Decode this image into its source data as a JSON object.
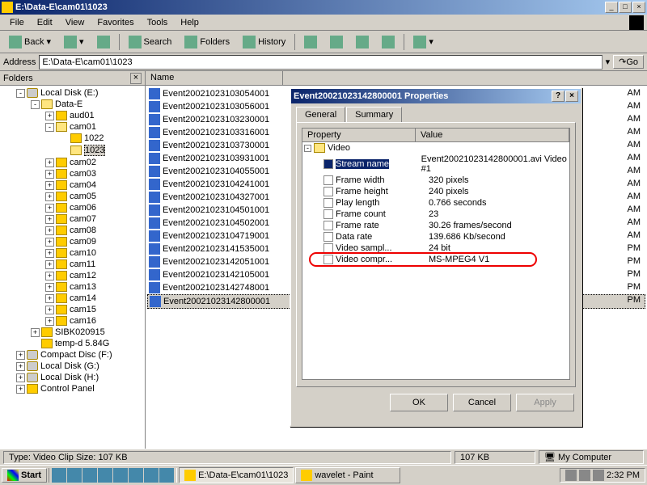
{
  "window": {
    "title": "E:\\Data-E\\cam01\\1023",
    "min": "_",
    "max": "□",
    "close": "×"
  },
  "menu": {
    "items": [
      "File",
      "Edit",
      "View",
      "Favorites",
      "Tools",
      "Help"
    ]
  },
  "toolbar": {
    "back": "Back",
    "search": "Search",
    "folders": "Folders",
    "history": "History"
  },
  "addressbar": {
    "label": "Address",
    "path": "E:\\Data-E\\cam01\\1023",
    "go": "Go"
  },
  "folders_panel": {
    "title": "Folders",
    "close": "×"
  },
  "tree": [
    {
      "pad": 2,
      "exp": "-",
      "icon": "disk",
      "label": "Local Disk (E:)"
    },
    {
      "pad": 4,
      "exp": "-",
      "icon": "open",
      "label": "Data-E"
    },
    {
      "pad": 6,
      "exp": "+",
      "icon": "folder",
      "label": "aud01"
    },
    {
      "pad": 6,
      "exp": "-",
      "icon": "open",
      "label": "cam01"
    },
    {
      "pad": 8,
      "exp": "",
      "icon": "folder",
      "label": "1022"
    },
    {
      "pad": 8,
      "exp": "",
      "icon": "open",
      "label": "1023",
      "sel": true
    },
    {
      "pad": 6,
      "exp": "+",
      "icon": "folder",
      "label": "cam02"
    },
    {
      "pad": 6,
      "exp": "+",
      "icon": "folder",
      "label": "cam03"
    },
    {
      "pad": 6,
      "exp": "+",
      "icon": "folder",
      "label": "cam04"
    },
    {
      "pad": 6,
      "exp": "+",
      "icon": "folder",
      "label": "cam05"
    },
    {
      "pad": 6,
      "exp": "+",
      "icon": "folder",
      "label": "cam06"
    },
    {
      "pad": 6,
      "exp": "+",
      "icon": "folder",
      "label": "cam07"
    },
    {
      "pad": 6,
      "exp": "+",
      "icon": "folder",
      "label": "cam08"
    },
    {
      "pad": 6,
      "exp": "+",
      "icon": "folder",
      "label": "cam09"
    },
    {
      "pad": 6,
      "exp": "+",
      "icon": "folder",
      "label": "cam10"
    },
    {
      "pad": 6,
      "exp": "+",
      "icon": "folder",
      "label": "cam11"
    },
    {
      "pad": 6,
      "exp": "+",
      "icon": "folder",
      "label": "cam12"
    },
    {
      "pad": 6,
      "exp": "+",
      "icon": "folder",
      "label": "cam13"
    },
    {
      "pad": 6,
      "exp": "+",
      "icon": "folder",
      "label": "cam14"
    },
    {
      "pad": 6,
      "exp": "+",
      "icon": "folder",
      "label": "cam15"
    },
    {
      "pad": 6,
      "exp": "+",
      "icon": "folder",
      "label": "cam16"
    },
    {
      "pad": 4,
      "exp": "+",
      "icon": "folder",
      "label": "SIBK020915"
    },
    {
      "pad": 4,
      "exp": "",
      "icon": "folder",
      "label": "temp-d 5.84G"
    },
    {
      "pad": 2,
      "exp": "+",
      "icon": "disk",
      "label": "Compact Disc (F:)"
    },
    {
      "pad": 2,
      "exp": "+",
      "icon": "disk",
      "label": "Local Disk (G:)"
    },
    {
      "pad": 2,
      "exp": "+",
      "icon": "disk",
      "label": "Local Disk (H:)"
    },
    {
      "pad": 2,
      "exp": "+",
      "icon": "folder",
      "label": "Control Panel"
    }
  ],
  "listview": {
    "col_name": "Name",
    "files": [
      "Event20021023103054001",
      "Event20021023103056001",
      "Event20021023103230001",
      "Event20021023103316001",
      "Event20021023103730001",
      "Event20021023103931001",
      "Event20021023104055001",
      "Event20021023104241001",
      "Event20021023104327001",
      "Event20021023104501001",
      "Event20021023104502001",
      "Event20021023104719001",
      "Event20021023141535001",
      "Event20021023142051001",
      "Event20021023142105001",
      "Event20021023142748001",
      "Event20021023142800001"
    ],
    "selected_index": 16,
    "times": [
      "AM",
      "AM",
      "AM",
      "AM",
      "AM",
      "AM",
      "AM",
      "AM",
      "AM",
      "AM",
      "AM",
      "AM",
      "PM",
      "PM",
      "PM",
      "PM",
      "PM"
    ]
  },
  "dialog": {
    "title": "Event20021023142800001 Properties",
    "help": "?",
    "close": "×",
    "tabs": {
      "general": "General",
      "summary": "Summary",
      "active": 1
    },
    "col_prop": "Property",
    "col_val": "Value",
    "group": "Video",
    "props": [
      {
        "name": "Stream name",
        "value": "Event20021023142800001.avi Video #1",
        "selected": true
      },
      {
        "name": "Frame width",
        "value": "320 pixels"
      },
      {
        "name": "Frame height",
        "value": "240 pixels"
      },
      {
        "name": "Play length",
        "value": "0.766 seconds"
      },
      {
        "name": "Frame count",
        "value": "23"
      },
      {
        "name": "Frame rate",
        "value": "30.26 frames/second"
      },
      {
        "name": "Data rate",
        "value": "139.686 Kb/second"
      },
      {
        "name": "Video sampl...",
        "value": "24 bit"
      },
      {
        "name": "Video compr...",
        "value": "MS-MPEG4 V1",
        "highlighted": true
      }
    ],
    "ok": "OK",
    "cancel": "Cancel",
    "apply": "Apply"
  },
  "statusbar": {
    "left": "Type: Video Clip Size: 107 KB",
    "size": "107 KB",
    "location": "My Computer"
  },
  "taskbar": {
    "start": "Start",
    "tasks": [
      {
        "label": "E:\\Data-E\\cam01\\1023",
        "active": true
      },
      {
        "label": "wavelet - Paint",
        "active": false
      }
    ],
    "time": "2:32 PM"
  }
}
